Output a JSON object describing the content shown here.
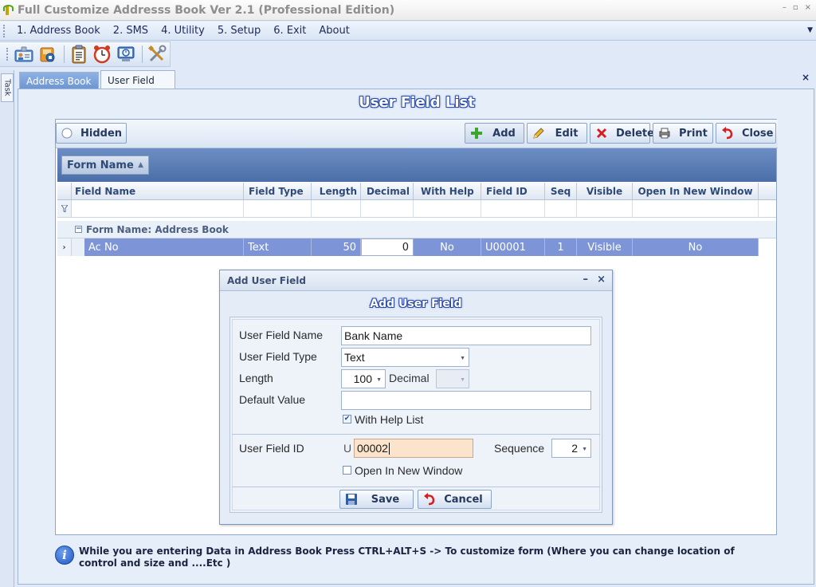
{
  "window": {
    "title": "Full Customize Addresss Book Ver 2.1 (Professional Edition)",
    "controls": [
      "–",
      "▫",
      "×"
    ]
  },
  "menu": {
    "items": [
      "1. Address Book",
      "2. SMS",
      "4. Utility",
      "5. Setup",
      "6. Exit",
      "About"
    ]
  },
  "task_strip": {
    "label": "Task"
  },
  "doc_tabs": {
    "items": [
      "Address Book",
      "User Field"
    ],
    "active": "User Field",
    "close": "×"
  },
  "page": {
    "title": "User Field List"
  },
  "toolbar": {
    "hidden_label": "Hidden",
    "add_label": "Add",
    "edit_label": "Edit",
    "delete_label": "Delete",
    "print_label": "Print",
    "close_label": "Close"
  },
  "grid": {
    "group_chip": "Form Name",
    "group_chip_arrow": "▲",
    "columns": [
      "Field Name",
      "Field Type",
      "Length",
      "Decimal",
      "With Help",
      "Field ID",
      "Seq",
      "Visible",
      "Open In New Window"
    ],
    "group_row": "Form Name: Address Book",
    "group_expander": "⊖",
    "row_indicator": "›",
    "rows": [
      {
        "field_name": "Ac No",
        "field_type": "Text",
        "length": "50",
        "decimal": "0",
        "with_help": "No",
        "field_id": "U00001",
        "seq": "1",
        "visible": "Visible",
        "open_in_new_window": "No"
      }
    ]
  },
  "dialog": {
    "title": "Add User Field",
    "heading": "Add User Field",
    "minimize": "–",
    "close": "×",
    "labels": {
      "user_field_name": "User Field Name",
      "user_field_type": "User Field Type",
      "length": "Length",
      "decimal": "Decimal",
      "default_value": "Default Value",
      "with_help_list": "With Help List",
      "user_field_id": "User Field ID",
      "sequence": "Sequence",
      "open_in_new_window": "Open In New Window"
    },
    "values": {
      "user_field_name": "Bank Name",
      "user_field_type": "Text",
      "length": "100",
      "decimal": "",
      "default_value": "",
      "with_help_list": true,
      "user_field_id_prefix": "U",
      "user_field_id": "00002",
      "sequence": "2",
      "open_in_new_window": false
    },
    "save_label": "Save",
    "cancel_label": "Cancel"
  },
  "info": {
    "icon": "i",
    "text": "While you are entering Data in Address Book  Press CTRL+ALT+S  ->  To customize form (Where you can change location of control and size and ....Etc )"
  },
  "colors": {
    "accent": "#7d95d6",
    "group_bar": "#5a7cb6",
    "panel": "#e6eef9"
  }
}
